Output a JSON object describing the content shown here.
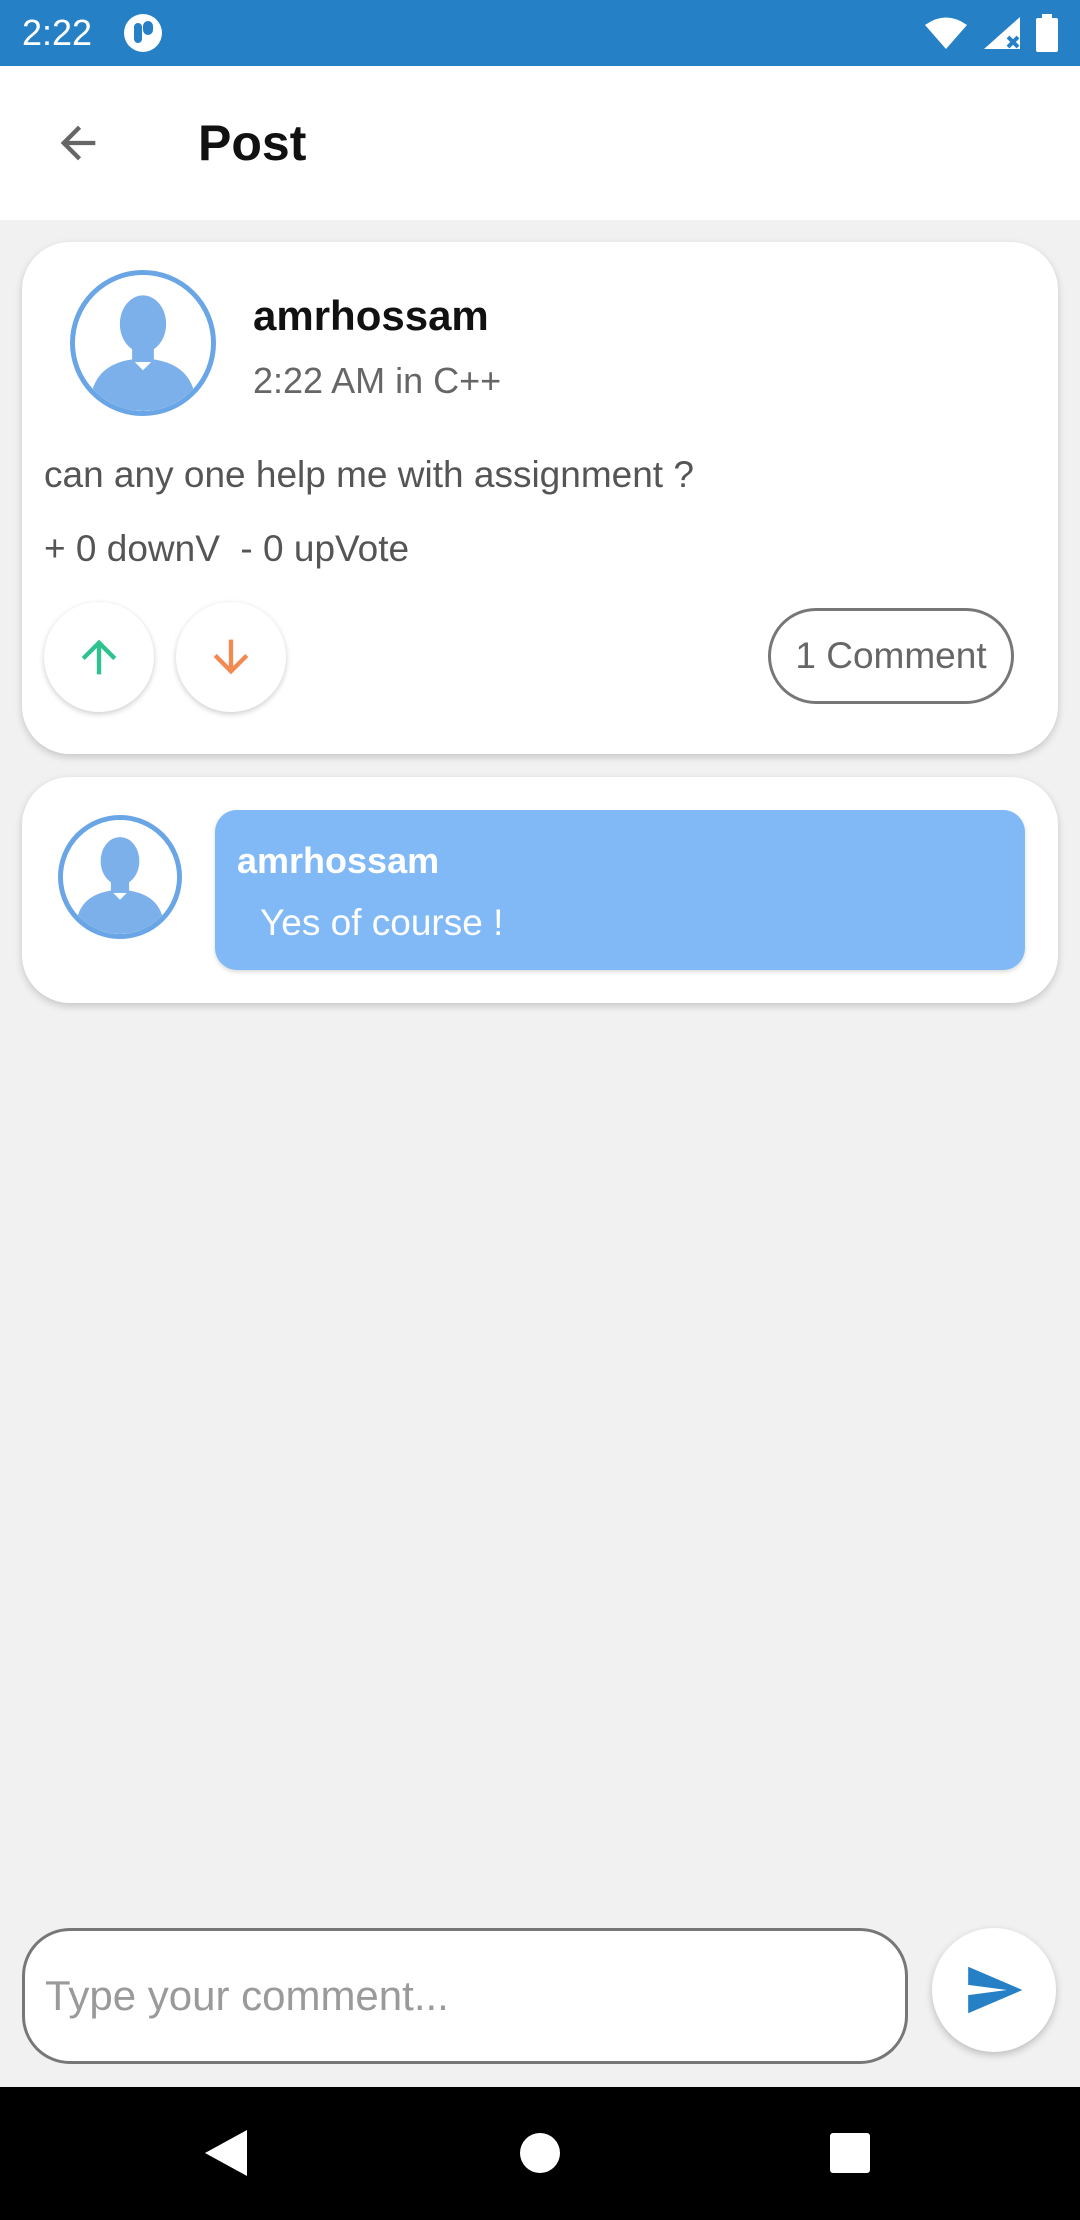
{
  "status_bar": {
    "time": "2:22"
  },
  "app_bar": {
    "title": "Post"
  },
  "post": {
    "author": "amrhossam",
    "meta": "2:22 AM in C++",
    "body": "can any one help me with assignment ?",
    "votes_text": "+ 0 downV  - 0 upVote",
    "comment_count_label": "1 Comment"
  },
  "comments": [
    {
      "author": "amrhossam",
      "text": "Yes of course !"
    }
  ],
  "composer": {
    "placeholder": "Type your comment..."
  },
  "colors": {
    "status_bar": "#2680c6",
    "avatar_accent": "#6aa6e6",
    "comment_bubble": "#80b9f5",
    "upvote": "#2ec28e",
    "downvote": "#f28a52",
    "send": "#2680c6"
  },
  "icons": {
    "back": "arrow-left-icon",
    "upvote": "arrow-up-icon",
    "downvote": "arrow-down-icon",
    "send": "send-icon",
    "avatar": "person-silhouette-icon"
  }
}
